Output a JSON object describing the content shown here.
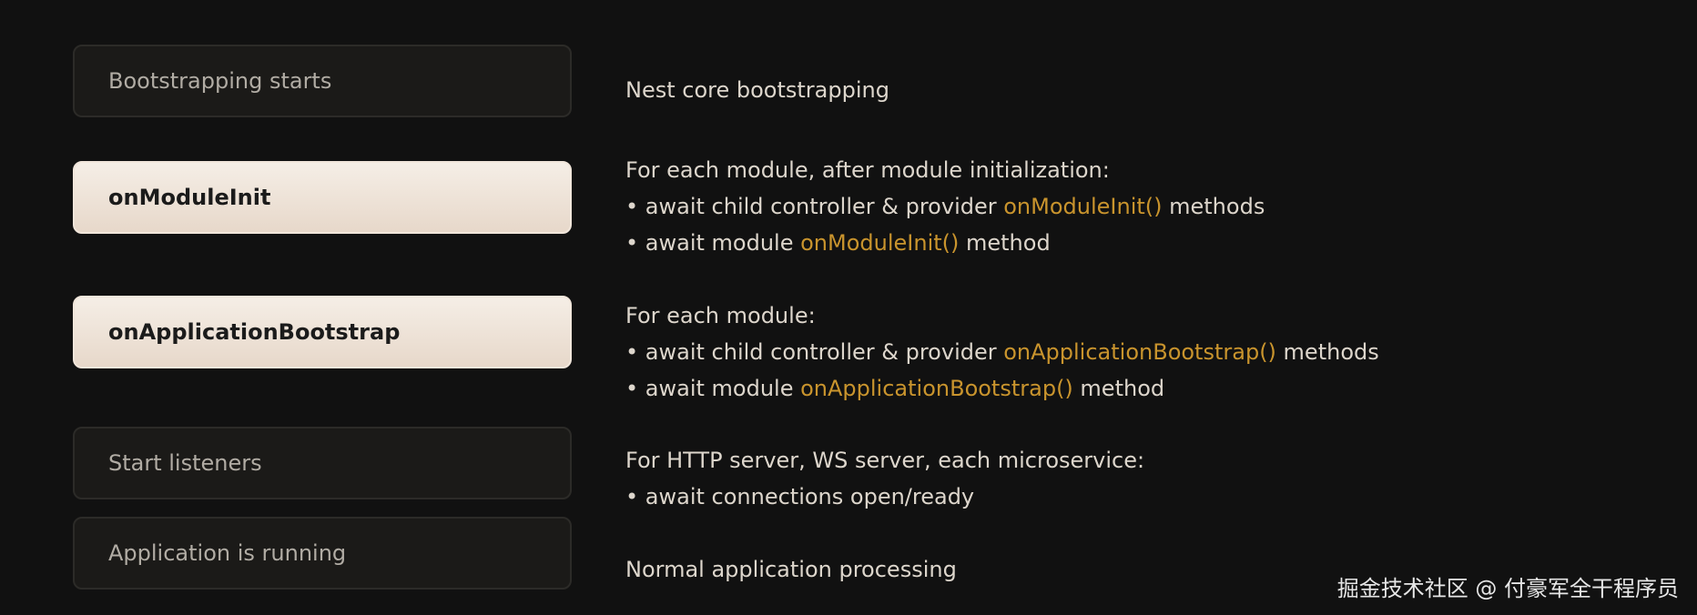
{
  "phases": [
    {
      "label": "Bootstrapping starts",
      "style": "dark",
      "description": {
        "lines": [
          [
            {
              "text": "Nest core bootstrapping",
              "hl": false
            }
          ]
        ]
      }
    },
    {
      "label": "onModuleInit",
      "style": "light",
      "description": {
        "lines": [
          [
            {
              "text": "For each module, after module initialization:",
              "hl": false
            }
          ],
          [
            {
              "text": "• await child controller & provider ",
              "hl": false
            },
            {
              "text": "onModuleInit()",
              "hl": true
            },
            {
              "text": " methods",
              "hl": false
            }
          ],
          [
            {
              "text": "• await module ",
              "hl": false
            },
            {
              "text": "onModuleInit()",
              "hl": true
            },
            {
              "text": " method",
              "hl": false
            }
          ]
        ]
      }
    },
    {
      "label": "onApplicationBootstrap",
      "style": "light",
      "description": {
        "lines": [
          [
            {
              "text": "For each module:",
              "hl": false
            }
          ],
          [
            {
              "text": "• await child controller & provider ",
              "hl": false
            },
            {
              "text": "onApplicationBootstrap()",
              "hl": true
            },
            {
              "text": " methods",
              "hl": false
            }
          ],
          [
            {
              "text": "• await module ",
              "hl": false
            },
            {
              "text": "onApplicationBootstrap()",
              "hl": true
            },
            {
              "text": " method",
              "hl": false
            }
          ]
        ]
      }
    },
    {
      "label": "Start listeners",
      "style": "dark",
      "description": {
        "lines": [
          [
            {
              "text": "For HTTP server, WS server, each microservice:",
              "hl": false
            }
          ],
          [
            {
              "text": "• await connections open/ready",
              "hl": false
            }
          ]
        ]
      }
    },
    {
      "label": "Application is running",
      "style": "dark",
      "description": {
        "lines": [
          [
            {
              "text": "Normal application processing",
              "hl": false
            }
          ]
        ]
      }
    }
  ],
  "colors": {
    "background": "#111111",
    "highlight": "#c9942d",
    "light_box": "#efe4d8",
    "dark_box": "#1b1a18"
  },
  "watermark": "掘金技术社区 @ 付豪军全干程序员"
}
